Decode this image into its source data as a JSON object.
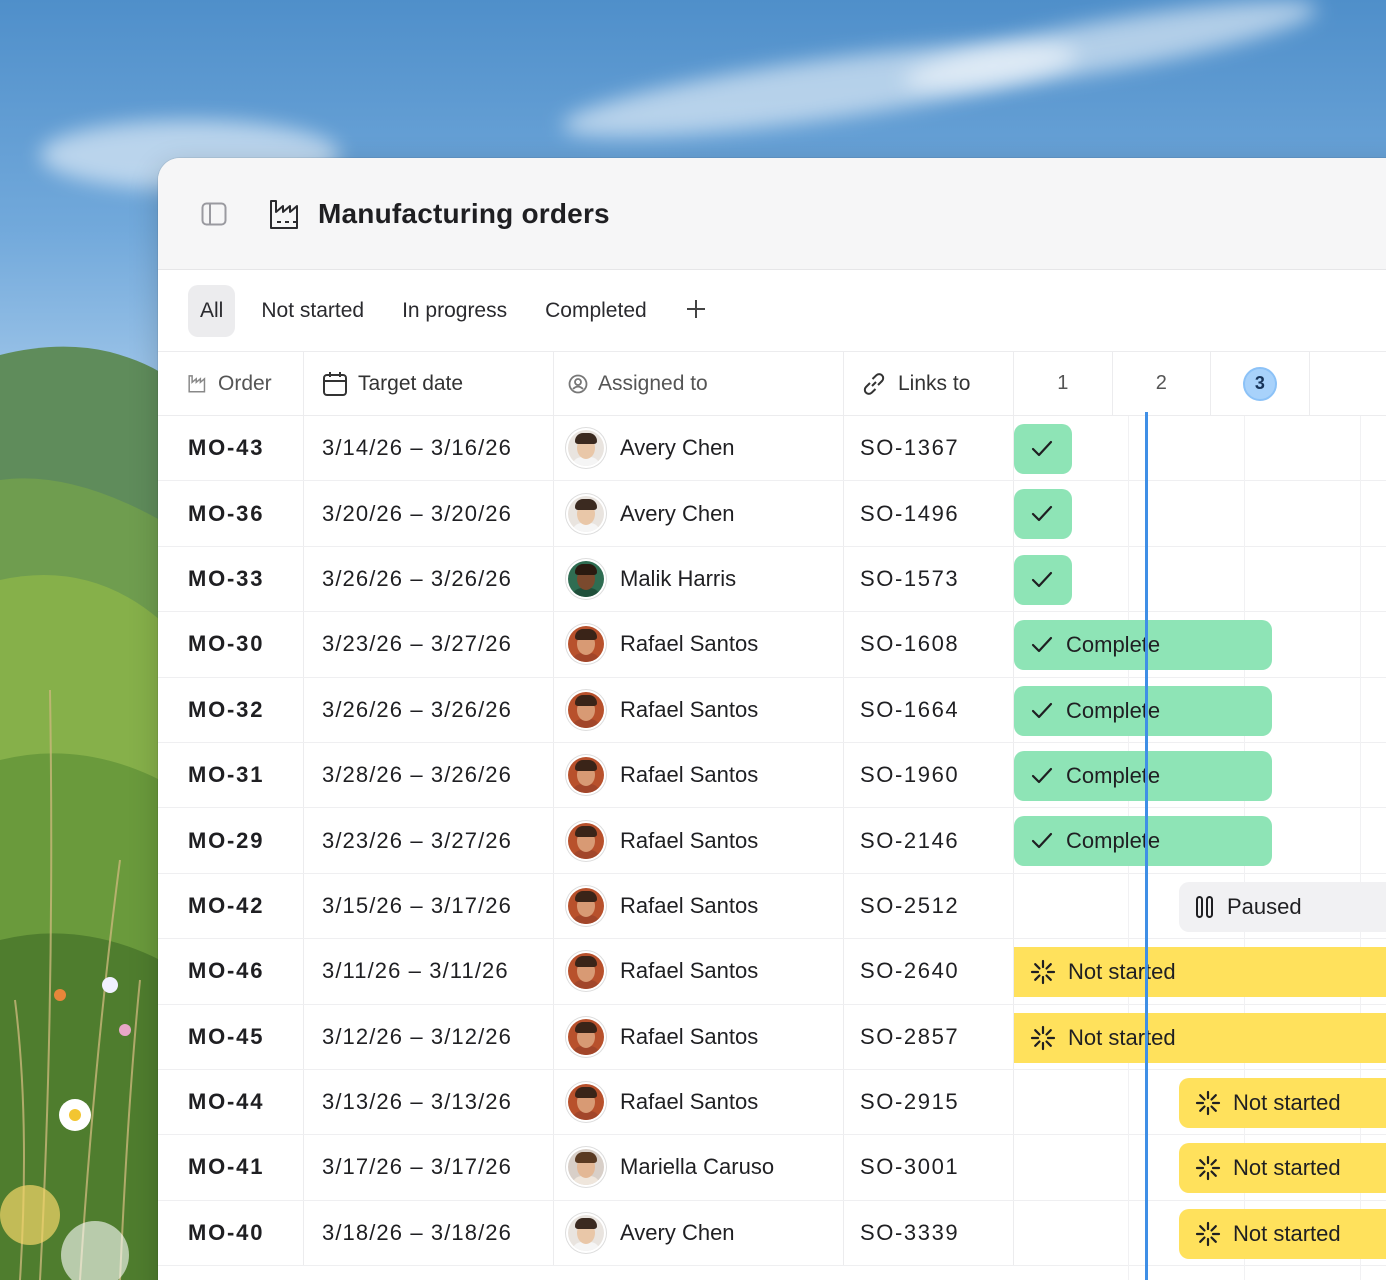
{
  "window": {
    "title": "Manufacturing orders"
  },
  "tabs": [
    {
      "label": "All",
      "active": true
    },
    {
      "label": "Not started",
      "active": false
    },
    {
      "label": "In progress",
      "active": false
    },
    {
      "label": "Completed",
      "active": false
    }
  ],
  "columns": {
    "order": "Order",
    "target_date": "Target date",
    "assigned_to": "Assigned to",
    "links_to": "Links to",
    "days": [
      "1",
      "2",
      "3"
    ],
    "today": "3"
  },
  "colors": {
    "complete": "#8ee4b6",
    "paused": "#f1f1f3",
    "not_started": "#ffe15c",
    "today_line": "#3f8fe6"
  },
  "rows": [
    {
      "order": "MO-43",
      "date": "3/14/26 – 3/16/26",
      "assignee": "Avery Chen",
      "link": "SO-1367",
      "status": "complete",
      "status_label": ""
    },
    {
      "order": "MO-36",
      "date": "3/20/26 – 3/20/26",
      "assignee": "Avery Chen",
      "link": "SO-1496",
      "status": "complete",
      "status_label": ""
    },
    {
      "order": "MO-33",
      "date": "3/26/26 – 3/26/26",
      "assignee": "Malik Harris",
      "link": "SO-1573",
      "status": "complete",
      "status_label": ""
    },
    {
      "order": "MO-30",
      "date": "3/23/26 – 3/27/26",
      "assignee": "Rafael Santos",
      "link": "SO-1608",
      "status": "complete",
      "status_label": "Complete"
    },
    {
      "order": "MO-32",
      "date": "3/26/26 – 3/26/26",
      "assignee": "Rafael Santos",
      "link": "SO-1664",
      "status": "complete",
      "status_label": "Complete"
    },
    {
      "order": "MO-31",
      "date": "3/28/26 – 3/26/26",
      "assignee": "Rafael Santos",
      "link": "SO-1960",
      "status": "complete",
      "status_label": "Complete"
    },
    {
      "order": "MO-29",
      "date": "3/23/26 – 3/27/26",
      "assignee": "Rafael Santos",
      "link": "SO-2146",
      "status": "complete",
      "status_label": "Complete"
    },
    {
      "order": "MO-42",
      "date": "3/15/26 – 3/17/26",
      "assignee": "Rafael Santos",
      "link": "SO-2512",
      "status": "paused",
      "status_label": "Paused"
    },
    {
      "order": "MO-46",
      "date": "3/11/26 – 3/11/26",
      "assignee": "Rafael Santos",
      "link": "SO-2640",
      "status": "not_started",
      "status_label": "Not started"
    },
    {
      "order": "MO-45",
      "date": "3/12/26 – 3/12/26",
      "assignee": "Rafael Santos",
      "link": "SO-2857",
      "status": "not_started",
      "status_label": "Not started"
    },
    {
      "order": "MO-44",
      "date": "3/13/26 – 3/13/26",
      "assignee": "Rafael Santos",
      "link": "SO-2915",
      "status": "not_started",
      "status_label": "Not started"
    },
    {
      "order": "MO-41",
      "date": "3/17/26 – 3/17/26",
      "assignee": "Mariella Caruso",
      "link": "SO-3001",
      "status": "not_started",
      "status_label": "Not started"
    },
    {
      "order": "MO-40",
      "date": "3/18/26 – 3/18/26",
      "assignee": "Avery Chen",
      "link": "SO-3339",
      "status": "not_started",
      "status_label": "Not started"
    }
  ]
}
